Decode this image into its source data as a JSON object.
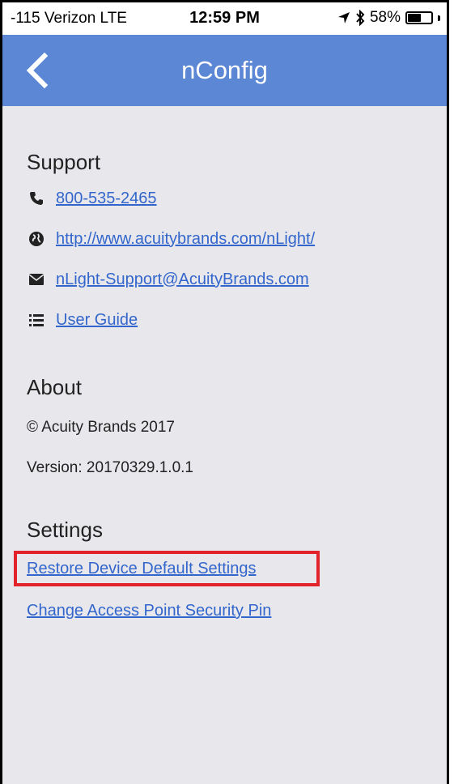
{
  "status_bar": {
    "carrier": "-115 Verizon  LTE",
    "time": "12:59 PM",
    "battery_percent": "58%",
    "battery_level": 0.58
  },
  "nav": {
    "title": "nConfig",
    "back_icon": "chevron-left-icon"
  },
  "support": {
    "heading": "Support",
    "phone": "800-535-2465",
    "website": "http://www.acuitybrands.com/nLight/",
    "email": "nLight-Support@AcuityBrands.com",
    "guide": "User Guide",
    "icons": [
      "phone-icon",
      "globe-icon",
      "envelope-icon",
      "list-icon"
    ]
  },
  "about": {
    "heading": "About",
    "copyright": "© Acuity Brands 2017",
    "version": "Version: 20170329.1.0.1"
  },
  "settings": {
    "heading": "Settings",
    "restore": "Restore Device Default Settings",
    "change_pin": "Change Access Point Security Pin"
  },
  "colors": {
    "nav_bg": "#5b87d4",
    "link": "#3366cc",
    "highlight": "#e3232c",
    "content_bg": "#e8e8ec"
  }
}
